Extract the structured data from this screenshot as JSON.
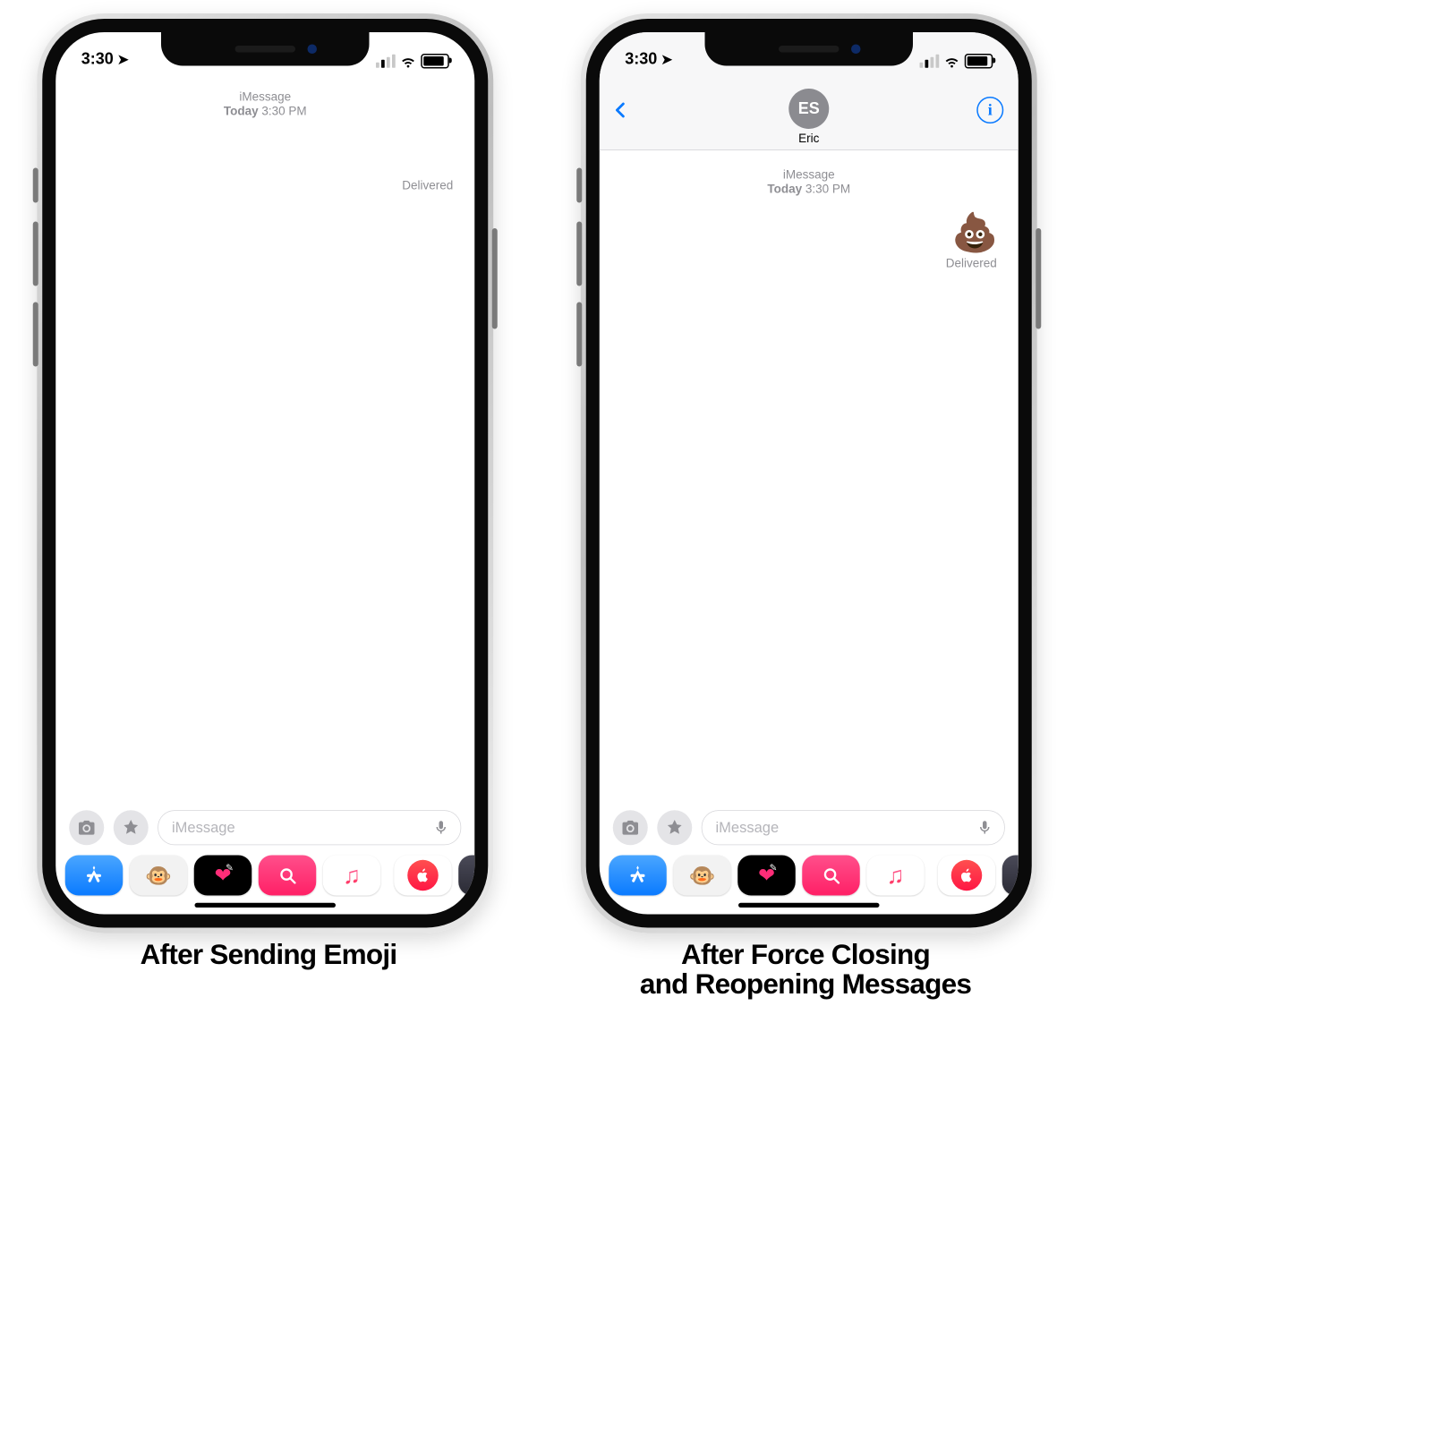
{
  "status": {
    "time": "3:30",
    "location_glyph": "➤"
  },
  "header": {
    "initials": "ES",
    "contact_name": "Eric",
    "info_glyph": "i"
  },
  "thread": {
    "service": "iMessage",
    "day": "Today",
    "time": "3:30 PM",
    "delivered": "Delivered",
    "emoji": "💩"
  },
  "compose": {
    "placeholder": "iMessage"
  },
  "tray": {
    "store_glyph": "A",
    "animoji_glyph": "🐵",
    "heart_glyph": "❤",
    "magnify_glyph": "⊕",
    "music_glyph": "♫",
    "apple_glyph": "",
    "ninja_glyph": "🥷"
  },
  "captions": {
    "left": "After Sending Emoji",
    "right_line1": "After Force Closing",
    "right_line2": "and Reopening Messages"
  }
}
